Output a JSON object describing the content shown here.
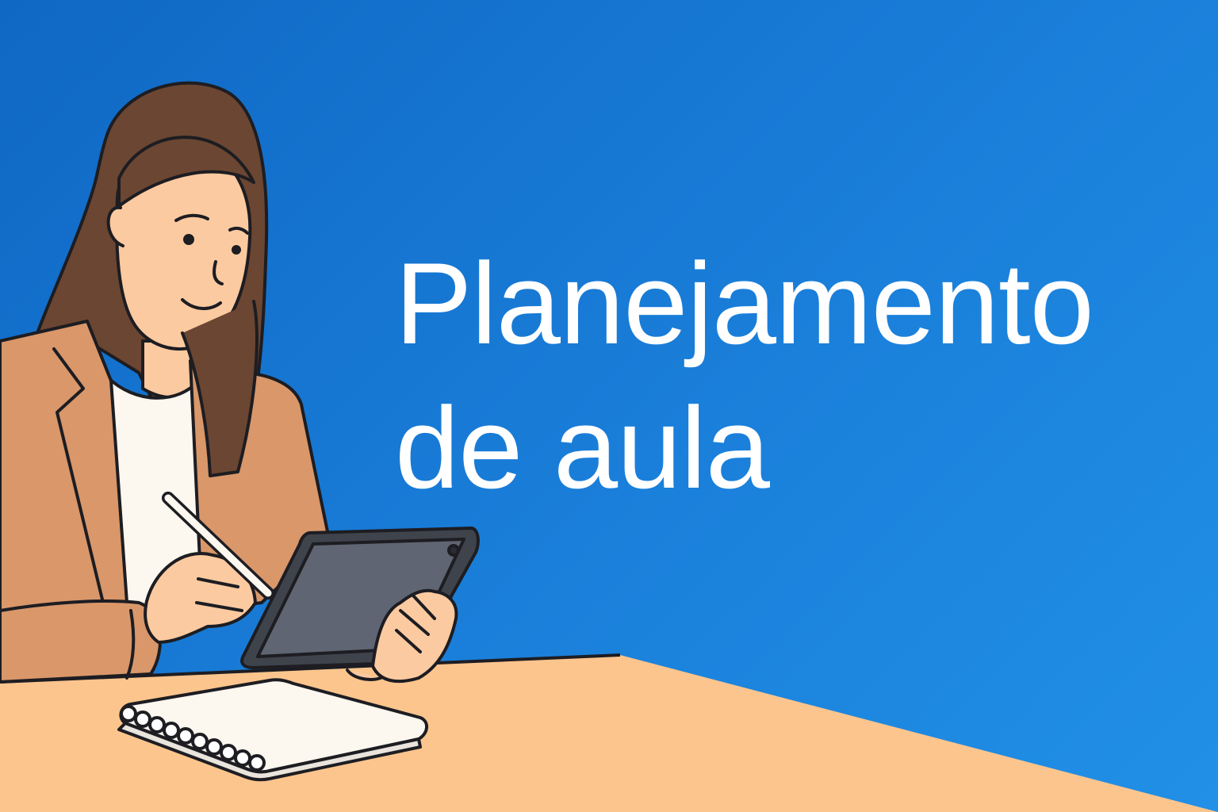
{
  "headline": {
    "line1": "Planejamento",
    "line2": "de aula"
  },
  "colors": {
    "background_start": "#0f68c4",
    "background_end": "#2190e6",
    "table": "#fcc58d",
    "blazer": "#d9976a",
    "hair": "#6b4632",
    "skin": "#fccaa0",
    "tablet": "#5f6572",
    "outline": "#1d1d22",
    "text": "#ffffff"
  },
  "icons": [
    "woman-illustration",
    "tablet-icon",
    "stylus-icon",
    "notebook-icon"
  ]
}
